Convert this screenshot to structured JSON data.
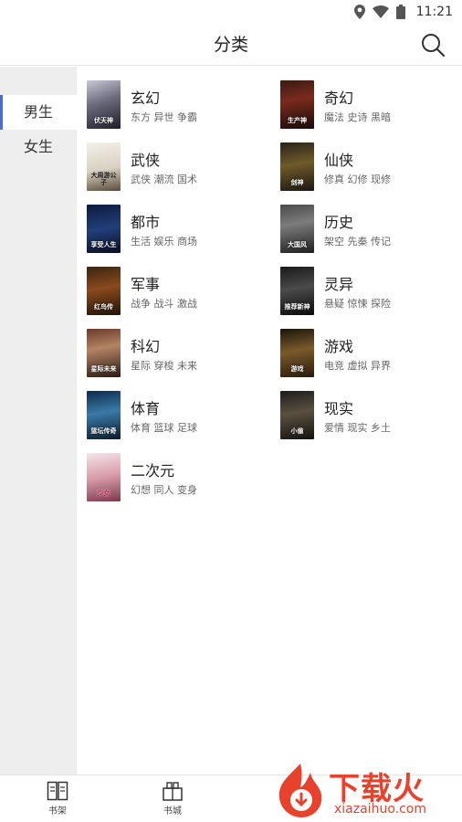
{
  "status_bar": {
    "time": "11:21",
    "icons": [
      "location-icon",
      "wifi-icon",
      "battery-icon"
    ]
  },
  "header": {
    "title": "分类",
    "search_icon": "search-icon"
  },
  "sidebar": {
    "items": [
      {
        "label": "男生",
        "active": true
      },
      {
        "label": "女生",
        "active": false
      }
    ]
  },
  "categories": [
    {
      "name": "玄幻",
      "tags": "东方 异世 争霸",
      "cover_text": "伏天神"
    },
    {
      "name": "奇幻",
      "tags": "魔法 史诗 黑暗",
      "cover_text": "生产神"
    },
    {
      "name": "武侠",
      "tags": "武侠 潮流 国术",
      "cover_text": "大周游公子"
    },
    {
      "name": "仙侠",
      "tags": "修真 幻修 现修",
      "cover_text": "剑神"
    },
    {
      "name": "都市",
      "tags": "生活 娱乐 商场",
      "cover_text": "享受人生"
    },
    {
      "name": "历史",
      "tags": "架空 先秦 传记",
      "cover_text": "大国风"
    },
    {
      "name": "军事",
      "tags": "战争 战斗 激战",
      "cover_text": "红鸟传"
    },
    {
      "name": "灵异",
      "tags": "悬疑 惊悚 探险",
      "cover_text": "推荐新神"
    },
    {
      "name": "科幻",
      "tags": "星际 穿梭 未来",
      "cover_text": "星际未来"
    },
    {
      "name": "游戏",
      "tags": "电竞 虚拟 异界",
      "cover_text": "游戏"
    },
    {
      "name": "体育",
      "tags": "体育 篮球 足球",
      "cover_text": "篮坛传奇"
    },
    {
      "name": "现实",
      "tags": "爱情 现实 乡土",
      "cover_text": "小偷"
    },
    {
      "name": "二次元",
      "tags": "幻想 同人 变身",
      "cover_text": "少女"
    }
  ],
  "bottom_nav": [
    {
      "label": "书架",
      "icon": "book-open-icon"
    },
    {
      "label": "书城",
      "icon": "store-icon"
    }
  ],
  "watermark": {
    "text": "下载火",
    "url": "xiazaihuo.com"
  },
  "colors": {
    "accent": "#4a6fd1",
    "sidebar_bg": "#eeeeee",
    "watermark": "#e8412c"
  }
}
